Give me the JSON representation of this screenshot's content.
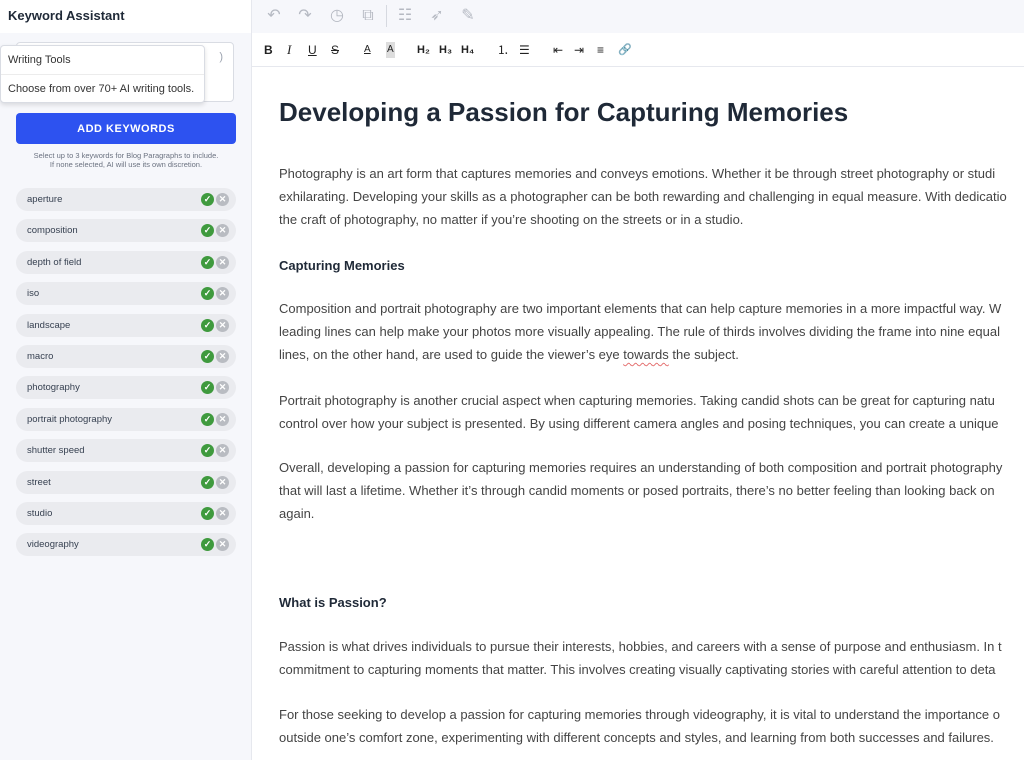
{
  "sidebar": {
    "title": "Keyword Assistant",
    "input_placeholder_visible": ")",
    "tooltip": {
      "title": "Writing Tools",
      "body": "Choose from over 70+ AI writing tools."
    },
    "add_button": "ADD KEYWORDS",
    "help_line1": "Select up to 3 keywords for Blog Paragraphs to include.",
    "help_line2": "If none selected, AI will use its own discretion.",
    "keywords": [
      "aperture",
      "composition",
      "depth of field",
      "iso",
      "landscape",
      "macro",
      "photography",
      "portrait photography",
      "shutter speed",
      "street",
      "studio",
      "videography"
    ]
  },
  "toolbar_top": {
    "icons": [
      "undo-icon",
      "redo-icon",
      "history-icon",
      "copy-icon",
      "list-view-icon",
      "rocket-icon",
      "pencil-icon"
    ]
  },
  "toolbar_format": {
    "bold": "B",
    "italic": "I",
    "underline": "U",
    "strike": "S",
    "font_color": "A",
    "highlight": "A",
    "h2": "H₂",
    "h3": "H₃",
    "h4": "H₄",
    "ordered_list": "⒈",
    "bullet_list": "☰",
    "outdent": "⇤",
    "indent": "⇥",
    "align": "≡",
    "link": "🔗"
  },
  "document": {
    "title": "Developing a Passion for Capturing Memories",
    "p1": [
      "Photography is an art form that captures memories and conveys emotions. Whether it be through street photography or studi",
      "exhilarating. Developing your skills as a photographer can be both rewarding and challenging in equal measure. With dedicatio",
      "the craft of photography, no matter if you’re shooting on the streets or in a studio."
    ],
    "h1": "Capturing Memories",
    "p2": [
      "Composition and portrait photography are two important elements that can help capture memories in a more impactful way. W",
      "leading lines can help make your photos more visually appealing. The rule of thirds involves dividing the frame into nine equal",
      "lines, on the other hand, are used to guide the viewer’s eye ",
      "towards",
      " the subject."
    ],
    "p3": [
      "Portrait photography is another crucial aspect when capturing memories. Taking candid shots can be great for capturing natu",
      "control over how your subject is presented. By using different camera angles and posing techniques, you can create a unique"
    ],
    "p4": [
      "Overall, developing a passion for capturing memories requires an understanding of both composition and portrait photography",
      "that will last a lifetime. Whether it’s through candid moments or posed portraits, there’s no better feeling than looking back on",
      "again."
    ],
    "h2": "What is Passion?",
    "p5": [
      "Passion is what drives individuals to pursue their interests, hobbies, and careers with a sense of purpose and enthusiasm. In t",
      "commitment to capturing moments that matter. This involves creating visually captivating stories with careful attention to deta"
    ],
    "p6": [
      "For those seeking to develop a passion for capturing memories through videography, it is vital to understand the importance o",
      "outside one’s comfort zone, experimenting with different concepts and styles, and learning from both successes and failures."
    ]
  },
  "colors": {
    "accent": "#2d52f0",
    "check": "#3f9a3e",
    "remove": "#b9bcc2"
  }
}
